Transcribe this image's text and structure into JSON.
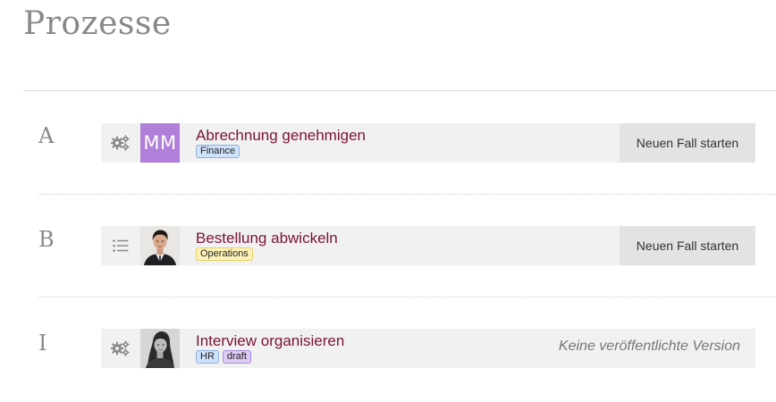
{
  "page": {
    "title": "Prozesse"
  },
  "groups": [
    {
      "letter": "A",
      "process": {
        "name": "Abrechnung genehmigen",
        "type_icon": "gears-icon",
        "avatar": {
          "kind": "initials",
          "initials": "MM",
          "color": "#b07fd9"
        },
        "tags": [
          {
            "label": "Finance",
            "bg": "#cfe2fb",
            "border": "#8fb0e0"
          }
        ],
        "action": {
          "kind": "button",
          "label": "Neuen Fall starten"
        }
      }
    },
    {
      "letter": "B",
      "process": {
        "name": "Bestellung abwickeln",
        "type_icon": "list-icon",
        "avatar": {
          "kind": "photo",
          "description": "man-portrait"
        },
        "tags": [
          {
            "label": "Operations",
            "bg": "#fdf3b8",
            "border": "#e3cf6a"
          }
        ],
        "action": {
          "kind": "button",
          "label": "Neuen Fall starten"
        }
      }
    },
    {
      "letter": "I",
      "process": {
        "name": "Interview organisieren",
        "type_icon": "gears-icon",
        "avatar": {
          "kind": "photo",
          "description": "woman-portrait"
        },
        "tags": [
          {
            "label": "HR",
            "bg": "#cfe2fb",
            "border": "#8fb0e0"
          },
          {
            "label": "draft",
            "bg": "#dccbf5",
            "border": "#a98bd6"
          }
        ],
        "action": {
          "kind": "text",
          "label": "Keine veröffentlichte Version"
        }
      }
    }
  ]
}
